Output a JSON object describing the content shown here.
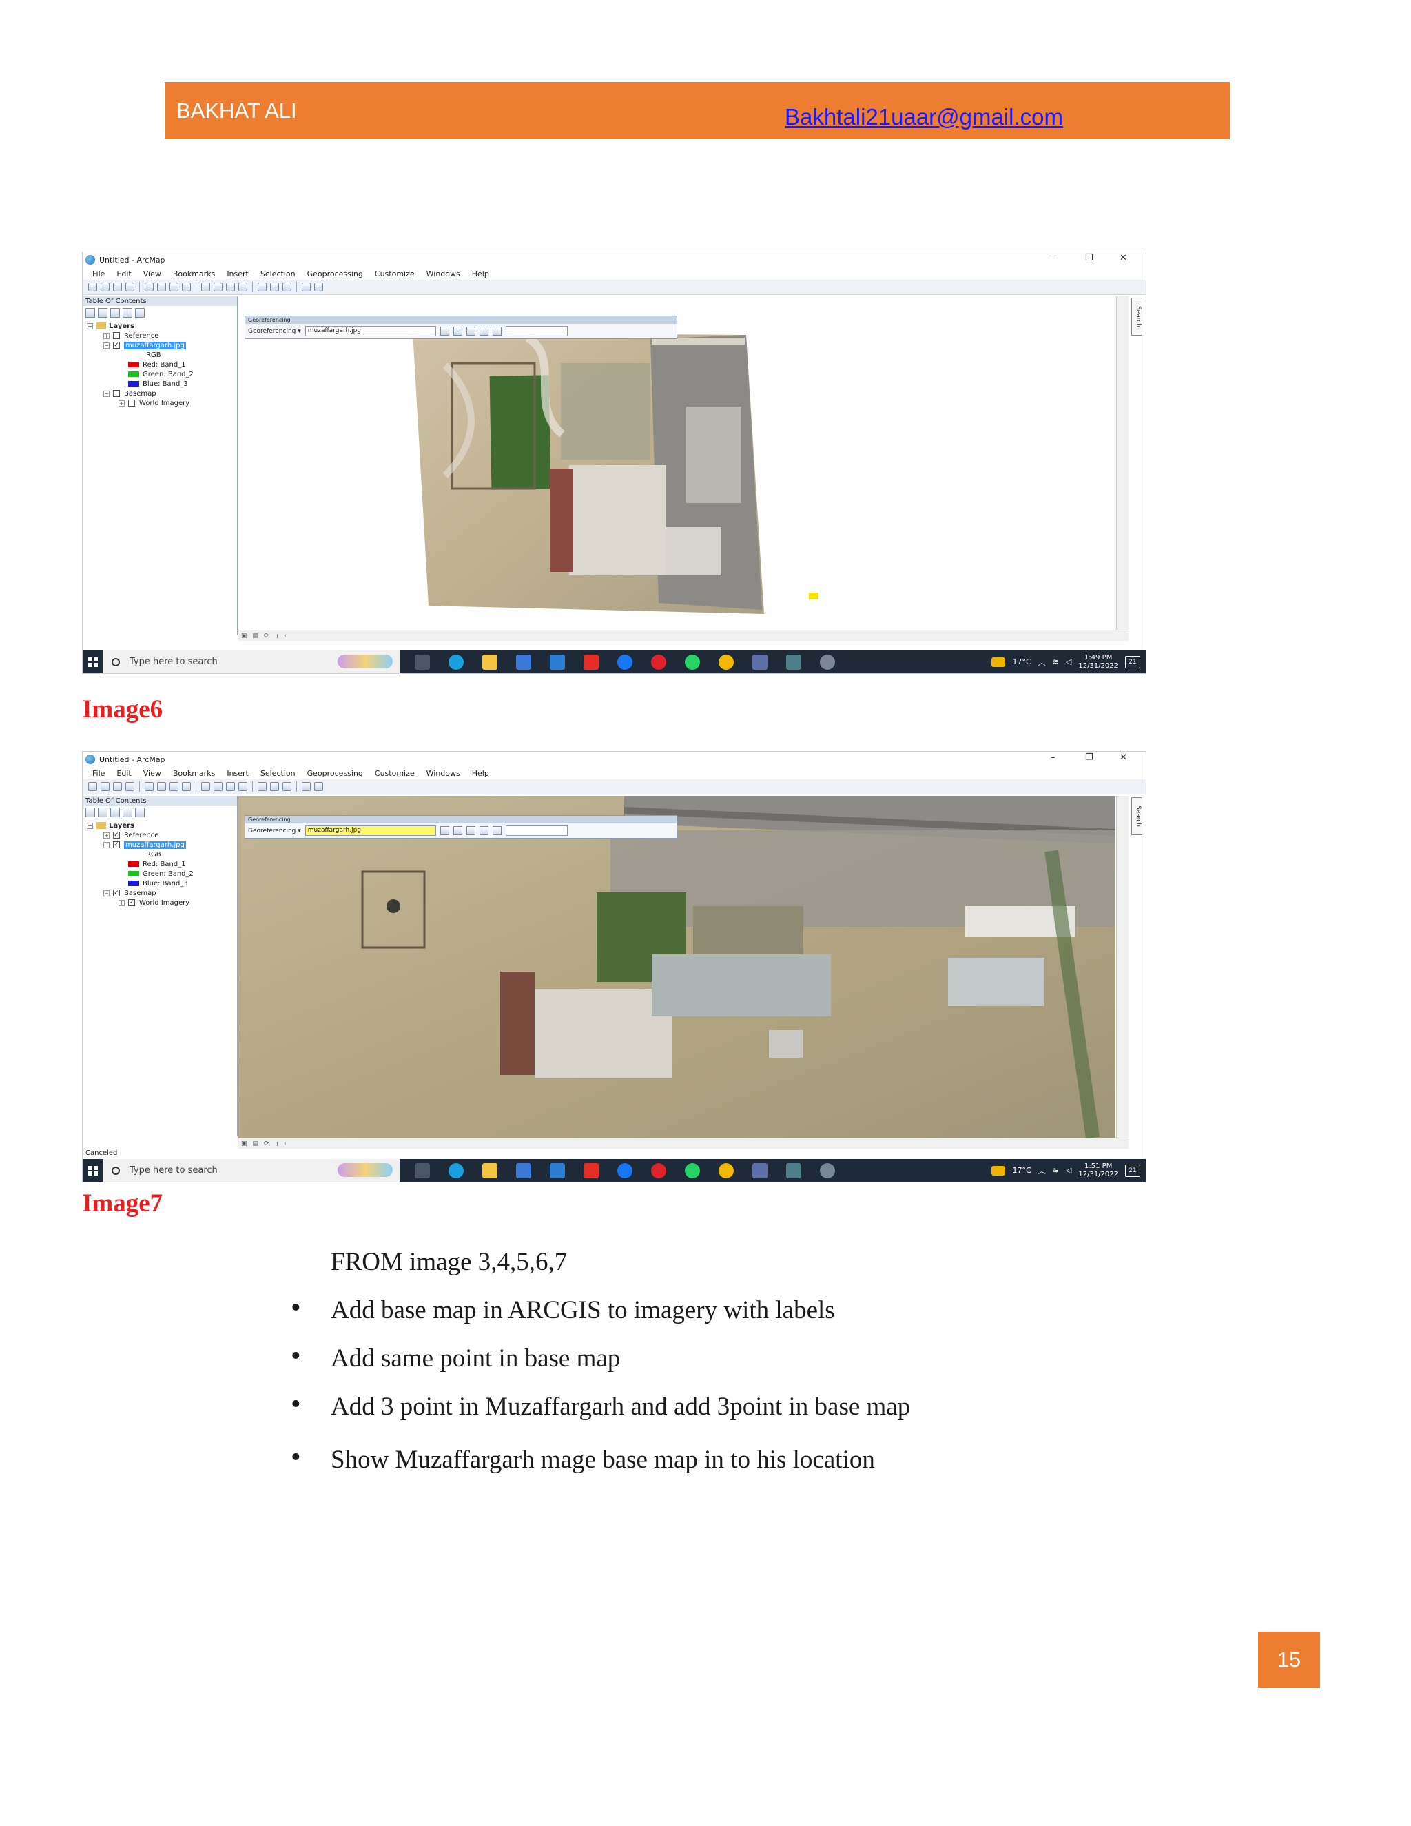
{
  "header": {
    "author": "BAKHAT ALI",
    "email": "Bakhtali21uaar@gmail.com"
  },
  "screenshots": [
    {
      "window_title": "Untitled - ArcMap",
      "menu": [
        "File",
        "Edit",
        "View",
        "Bookmarks",
        "Insert",
        "Selection",
        "Geoprocessing",
        "Customize",
        "Windows",
        "Help"
      ],
      "toc_title": "Table Of Contents",
      "toc": {
        "layers": "Layers",
        "reference": "Reference",
        "image_layer": "muzaffargarh.jpg",
        "rgb": "RGB",
        "red": "Red:   Band_1",
        "green": "Green: Band_2",
        "blue": "Blue:  Band_3",
        "basemap": "Basemap",
        "world_imagery": "World Imagery"
      },
      "georef_title": "Georeferencing",
      "georef_menu": "Georeferencing ▾",
      "georef_layer": "muzaffargarh.jpg",
      "search_tab": "Search",
      "status": "",
      "taskbar_search": "Type here to search",
      "temperature": "17°C",
      "time": "1:49 PM",
      "date": "12/31/2022",
      "notifications": "21",
      "colors": {
        "red": "#e60000",
        "green": "#1fbf1f",
        "blue": "#1a1adb"
      }
    },
    {
      "window_title": "Untitled - ArcMap",
      "menu": [
        "File",
        "Edit",
        "View",
        "Bookmarks",
        "Insert",
        "Selection",
        "Geoprocessing",
        "Customize",
        "Windows",
        "Help"
      ],
      "toc_title": "Table Of Contents",
      "toc": {
        "layers": "Layers",
        "reference": "Reference",
        "image_layer": "muzaffargarh.jpg",
        "rgb": "RGB",
        "red": "Red:   Band_1",
        "green": "Green: Band_2",
        "blue": "Blue:  Band_3",
        "basemap": "Basemap",
        "world_imagery": "World Imagery"
      },
      "georef_title": "Georeferencing",
      "georef_menu": "Georeferencing ▾",
      "georef_layer": "muzaffargarh.jpg",
      "search_tab": "Search",
      "status": "Canceled",
      "taskbar_search": "Type here to search",
      "temperature": "17°C",
      "time": "1:51 PM",
      "date": "12/31/2022",
      "notifications": "21",
      "colors": {
        "red": "#e60000",
        "green": "#1fbf1f",
        "blue": "#1a1adb"
      }
    }
  ],
  "captions": [
    "Image6",
    "Image7"
  ],
  "intro": "FROM image 3,4,5,6,7",
  "bullets": [
    "Add base map  in ARCGIS to imagery with labels",
    "Add same point in base map",
    "Add 3 point in Muzaffargarh and add 3point in base map",
    "Show Muzaffargarh mage base map in to his location"
  ],
  "page_number": "15",
  "colors": {
    "accent": "#ED7D31",
    "caption": "#e81f1f",
    "link": "#1a1aff"
  }
}
